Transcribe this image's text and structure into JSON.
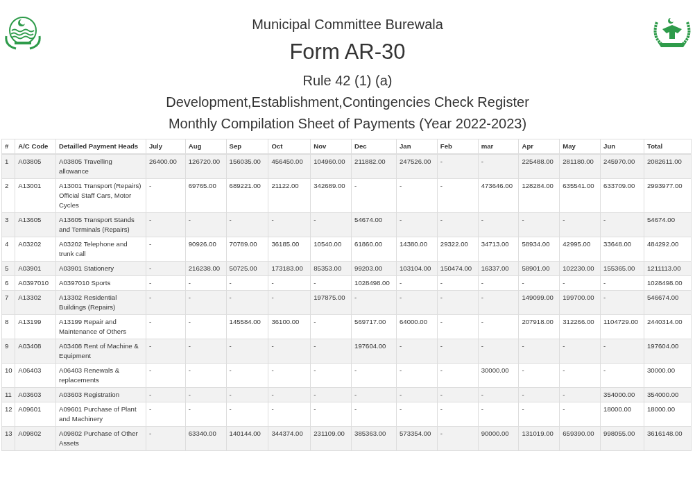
{
  "header": {
    "organization": "Municipal Committee Burewala",
    "form": "Form AR-30",
    "rule": "Rule 42 (1) (a)",
    "register": "Development,Establishment,Contingencies Check Register",
    "sheet": "Monthly Compilation Sheet of Payments (Year 2022-2023)"
  },
  "table": {
    "columns": [
      "#",
      "A/C Code",
      "Detailled Payment Heads",
      "July",
      "Aug",
      "Sep",
      "Oct",
      "Nov",
      "Dec",
      "Jan",
      "Feb",
      "mar",
      "Apr",
      "May",
      "Jun",
      "Total"
    ],
    "rows": [
      [
        "1",
        "A03805",
        "A03805 Travelling allowance",
        "26400.00",
        "126720.00",
        "156035.00",
        "456450.00",
        "104960.00",
        "211882.00",
        "247526.00",
        "-",
        "-",
        "225488.00",
        "281180.00",
        "245970.00",
        "2082611.00"
      ],
      [
        "2",
        "A13001",
        "A13001 Transport (Repairs) Official Staff Cars, Motor Cycles",
        "-",
        "69765.00",
        "689221.00",
        "21122.00",
        "342689.00",
        "-",
        "-",
        "-",
        "473646.00",
        "128284.00",
        "635541.00",
        "633709.00",
        "2993977.00"
      ],
      [
        "3",
        "A13605",
        "A13605 Transport Stands and Terminals (Repairs)",
        "-",
        "-",
        "-",
        "-",
        "-",
        "54674.00",
        "-",
        "-",
        "-",
        "-",
        "-",
        "-",
        "54674.00"
      ],
      [
        "4",
        "A03202",
        "A03202 Telephone and trunk call",
        "-",
        "90926.00",
        "70789.00",
        "36185.00",
        "10540.00",
        "61860.00",
        "14380.00",
        "29322.00",
        "34713.00",
        "58934.00",
        "42995.00",
        "33648.00",
        "484292.00"
      ],
      [
        "5",
        "A03901",
        "A03901 Stationery",
        "-",
        "216238.00",
        "50725.00",
        "173183.00",
        "85353.00",
        "99203.00",
        "103104.00",
        "150474.00",
        "16337.00",
        "58901.00",
        "102230.00",
        "155365.00",
        "1211113.00"
      ],
      [
        "6",
        "A0397010",
        "A0397010 Sports",
        "-",
        "-",
        "-",
        "-",
        "-",
        "1028498.00",
        "-",
        "-",
        "-",
        "-",
        "-",
        "-",
        "1028498.00"
      ],
      [
        "7",
        "A13302",
        "A13302 Residential Buildings (Repairs)",
        "-",
        "-",
        "-",
        "-",
        "197875.00",
        "-",
        "-",
        "-",
        "-",
        "149099.00",
        "199700.00",
        "-",
        "546674.00"
      ],
      [
        "8",
        "A13199",
        "A13199 Repair and Maintenance of Others",
        "-",
        "-",
        "145584.00",
        "36100.00",
        "-",
        "569717.00",
        "64000.00",
        "-",
        "-",
        "207918.00",
        "312266.00",
        "1104729.00",
        "2440314.00"
      ],
      [
        "9",
        "A03408",
        "A03408 Rent of Machine & Equipment",
        "-",
        "-",
        "-",
        "-",
        "-",
        "197604.00",
        "-",
        "-",
        "-",
        "-",
        "-",
        "-",
        "197604.00"
      ],
      [
        "10",
        "A06403",
        "A06403 Renewals & replacements",
        "-",
        "-",
        "-",
        "-",
        "-",
        "-",
        "-",
        "-",
        "30000.00",
        "-",
        "-",
        "-",
        "30000.00"
      ],
      [
        "11",
        "A03603",
        "A03603 Registration",
        "-",
        "-",
        "-",
        "-",
        "-",
        "-",
        "-",
        "-",
        "-",
        "-",
        "-",
        "354000.00",
        "354000.00"
      ],
      [
        "12",
        "A09601",
        "A09601 Purchase of Plant and Machinery",
        "-",
        "-",
        "-",
        "-",
        "-",
        "-",
        "-",
        "-",
        "-",
        "-",
        "-",
        "18000.00",
        "18000.00"
      ],
      [
        "13",
        "A09802",
        "A09802 Purchase of Other Assets",
        "-",
        "63340.00",
        "140144.00",
        "344374.00",
        "231109.00",
        "385363.00",
        "573354.00",
        "-",
        "90000.00",
        "131019.00",
        "659390.00",
        "998055.00",
        "3616148.00"
      ]
    ]
  }
}
